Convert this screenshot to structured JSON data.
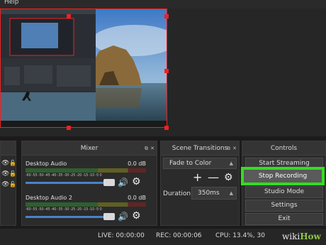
{
  "menu": {
    "help": "Help"
  },
  "sources": {
    "rows": 3
  },
  "mixer": {
    "title": "Mixer",
    "channels": [
      {
        "name": "Desktop Audio",
        "db": "0.0 dB"
      },
      {
        "name": "Desktop Audio 2",
        "db": "0.0 dB"
      }
    ],
    "ticks": "-60 -55 -50 -45 -40 -35 -30 -25 -20 -15 -10 -5 0"
  },
  "transitions": {
    "title": "Scene Transitions",
    "selected": "Fade to Color",
    "duration_label": "Duration",
    "duration_value": "350ms"
  },
  "controls": {
    "title": "Controls",
    "buttons": {
      "start_streaming": "Start Streaming",
      "stop_recording": "Stop Recording",
      "studio_mode": "Studio Mode",
      "settings": "Settings",
      "exit": "Exit"
    }
  },
  "status": {
    "live": "LIVE: 00:00:00",
    "rec": "REC: 00:00:06",
    "cpu": "CPU: 13.4%, 30"
  },
  "watermark": {
    "part1": "wiki",
    "part2": "How"
  },
  "colors": {
    "highlight": "#33dd22",
    "selection": "#ee2222",
    "slider": "#4a82c8"
  }
}
